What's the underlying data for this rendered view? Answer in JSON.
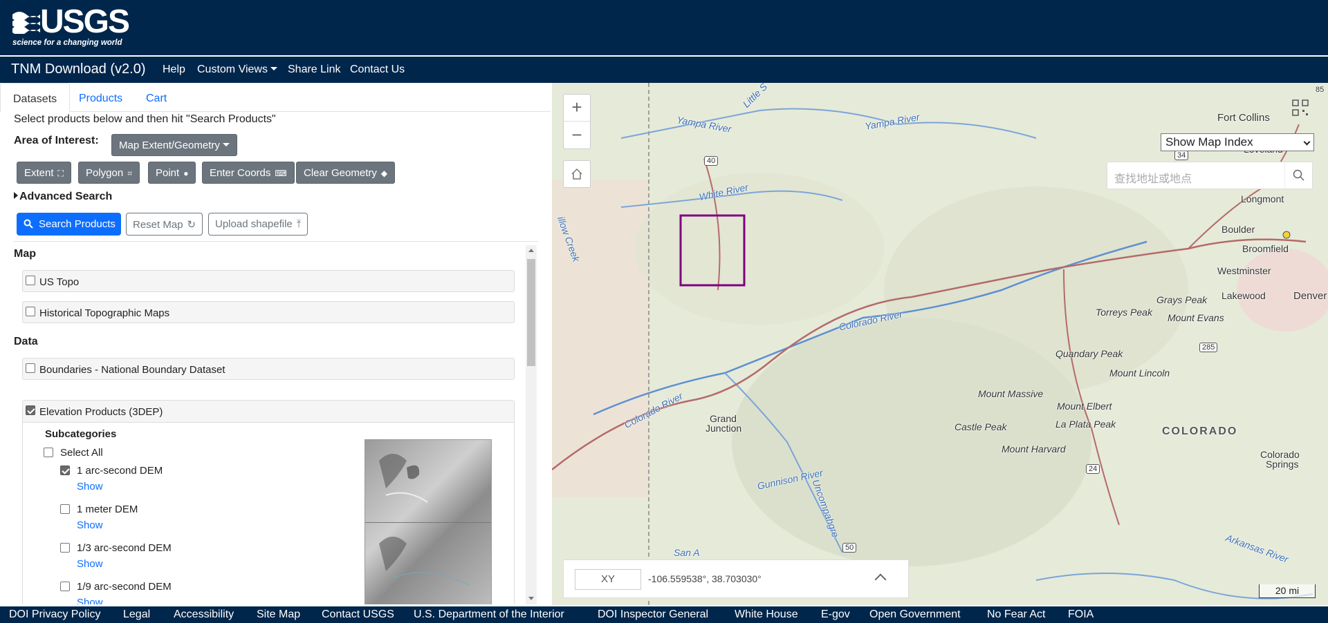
{
  "header": {
    "logo_word": "USGS",
    "logo_tagline": "science for a changing world"
  },
  "nav": {
    "brand": "TNM Download (v2.0)",
    "items": [
      "Help",
      "Custom Views",
      "Share Link",
      "Contact Us"
    ]
  },
  "tabs": [
    "Datasets",
    "Products",
    "Cart"
  ],
  "panel": {
    "instructions": "Select products below and then hit \"Search Products\"",
    "aoi_label": "Area of Interest:",
    "aoi_dropdown": "Map Extent/Geometry",
    "geometry_buttons": [
      "Extent",
      "Polygon",
      "Point",
      "Enter Coords",
      "Clear Geometry"
    ],
    "advanced_search": "Advanced Search",
    "search_button": "Search Products",
    "reset_button": "Reset Map",
    "upload_button": "Upload shapefile"
  },
  "datasets": {
    "map_heading": "Map",
    "map_items": [
      {
        "label": "US Topo",
        "checked": false
      },
      {
        "label": "Historical Topographic Maps",
        "checked": false
      }
    ],
    "data_heading": "Data",
    "data_items": [
      {
        "label": "Boundaries - National Boundary Dataset",
        "checked": false
      },
      {
        "label": "Elevation Products (3DEP)",
        "checked": true
      }
    ],
    "subcategories_heading": "Subcategories",
    "select_all": "Select All",
    "subcategories": [
      {
        "label": "1 arc-second DEM",
        "checked": true,
        "link": "Show"
      },
      {
        "label": "1 meter DEM",
        "checked": false,
        "link": "Show"
      },
      {
        "label": "1/3 arc-second DEM",
        "checked": false,
        "link": "Show"
      },
      {
        "label": "1/9 arc-second DEM",
        "checked": false,
        "link": "Show"
      }
    ]
  },
  "map": {
    "index_select": "Show Map Index",
    "search_placeholder": "查找地址或地点",
    "coord_mode": "XY",
    "coord_value": "-106.559538°, 38.703030°",
    "scale": "20 mi",
    "labels": {
      "places": [
        "Fort Collins",
        "Loveland",
        "Longmont",
        "Boulder",
        "Broomfield",
        "Westminster",
        "Lakewood",
        "Denver",
        "Grand",
        "Junction",
        "Colorado",
        "Springs"
      ],
      "state": "COLORADO",
      "peaks": [
        "Grays Peak",
        "Torreys Peak",
        "Mount Evans",
        "Quandary Peak",
        "Mount Lincoln",
        "Mount Massive",
        "Mount Elbert",
        "Castle Peak",
        "La Plata Peak",
        "Mount Harvard"
      ],
      "rivers": [
        "Yampa River",
        "Yampa River",
        "White River",
        "Colorado River",
        "Colorado River",
        "Gunnison River",
        "Uncompahgre",
        "Arkansas River",
        "Little S",
        "illow Creek",
        "San A"
      ],
      "highways": [
        "40",
        "34",
        "285",
        "24",
        "50"
      ],
      "edge_number": "85"
    }
  },
  "footer": {
    "links": [
      "DOI Privacy Policy",
      "Legal",
      "Accessibility",
      "Site Map",
      "Contact USGS",
      "U.S. Department of the Interior",
      "DOI Inspector General",
      "White House",
      "E-gov",
      "Open Government",
      "No Fear Act",
      "FOIA"
    ]
  },
  "colors": {
    "header_bg": "#00264c",
    "primary": "#0d6efd",
    "secondary": "#6c757d",
    "aoi_box": "#800080"
  }
}
